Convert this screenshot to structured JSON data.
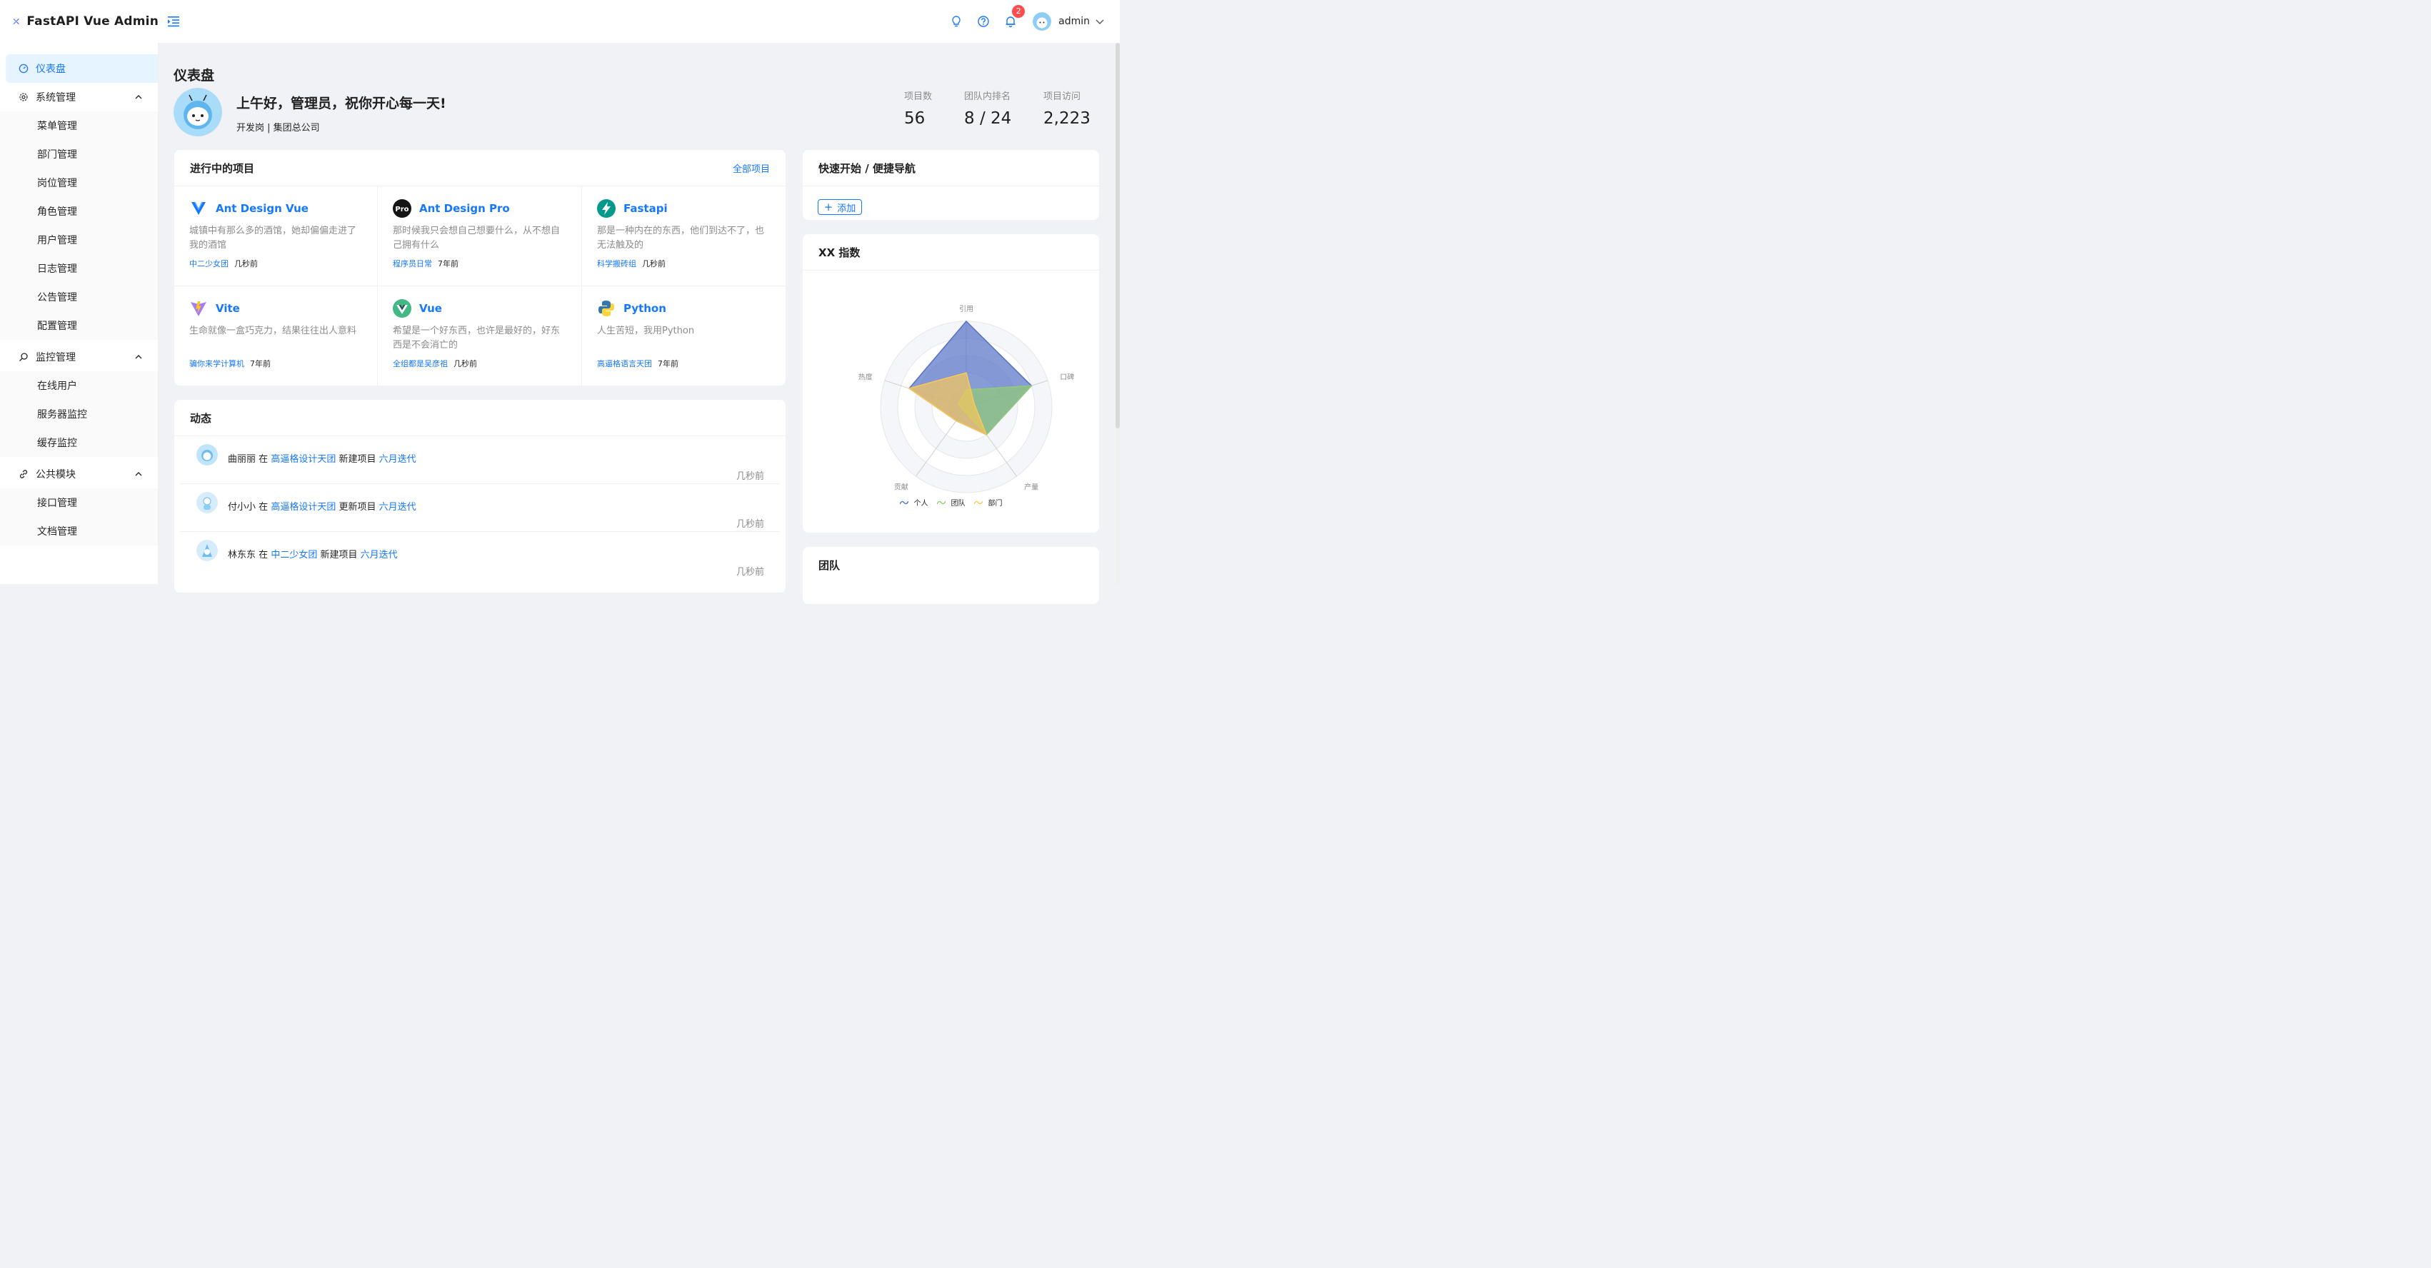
{
  "app": {
    "title": "FastAPI Vue Admin"
  },
  "header": {
    "notification_count": "2",
    "username": "admin",
    "icons": [
      "bulb-icon",
      "question-icon",
      "bell-icon",
      "chevron-down-icon"
    ]
  },
  "sidebar": {
    "dashboard": "仪表盘",
    "groups": [
      {
        "label": "系统管理",
        "icon": "gear-icon",
        "items": [
          "菜单管理",
          "部门管理",
          "岗位管理",
          "角色管理",
          "用户管理",
          "日志管理",
          "公告管理",
          "配置管理"
        ]
      },
      {
        "label": "监控管理",
        "icon": "search-icon",
        "items": [
          "在线用户",
          "服务器监控",
          "缓存监控"
        ]
      },
      {
        "label": "公共模块",
        "icon": "link-icon",
        "items": [
          "接口管理",
          "文档管理"
        ]
      }
    ]
  },
  "page": {
    "title": "仪表盘",
    "greeting": "上午好，管理员，祝你开心每一天!",
    "subtitle": "开发岗 | 集团总公司",
    "stats": [
      {
        "label": "项目数",
        "value": "56"
      },
      {
        "label": "团队内排名",
        "value": "8 / 24"
      },
      {
        "label": "项目访问",
        "value": "2,223"
      }
    ]
  },
  "projects": {
    "title": "进行中的项目",
    "all_link": "全部项目",
    "items": [
      {
        "name": "Ant Design Vue",
        "desc": "城镇中有那么多的酒馆，她却偏偏走进了我的酒馆",
        "group": "中二少女团",
        "time": "几秒前",
        "icon": "antdv-icon"
      },
      {
        "name": "Ant Design Pro",
        "desc": "那时候我只会想自己想要什么，从不想自己拥有什么",
        "group": "程序员日常",
        "time": "7年前",
        "icon": "pro-icon",
        "icon_text": "Pro"
      },
      {
        "name": "Fastapi",
        "desc": "那是一种内在的东西，他们到达不了，也无法触及的",
        "group": "科学搬砖组",
        "time": "几秒前",
        "icon": "fastapi-icon"
      },
      {
        "name": "Vite",
        "desc": "生命就像一盒巧克力，结果往往出人意料",
        "group": "骗你来学计算机",
        "time": "7年前",
        "icon": "vite-icon"
      },
      {
        "name": "Vue",
        "desc": "希望是一个好东西，也许是最好的，好东西是不会消亡的",
        "group": "全组都是吴彦祖",
        "time": "几秒前",
        "icon": "vue-icon"
      },
      {
        "name": "Python",
        "desc": "人生苦短，我用Python",
        "group": "高逼格语言天团",
        "time": "7年前",
        "icon": "python-icon"
      }
    ]
  },
  "dynamics": {
    "title": "动态",
    "items": [
      {
        "user": "曲丽丽",
        "at": "在",
        "group": "高逼格设计天团",
        "action": "新建项目",
        "target": "六月迭代",
        "time": "几秒前"
      },
      {
        "user": "付小小",
        "at": "在",
        "group": "高逼格设计天团",
        "action": "更新项目",
        "target": "六月迭代",
        "time": "几秒前"
      },
      {
        "user": "林东东",
        "at": "在",
        "group": "中二少女团",
        "action": "新建项目",
        "target": "六月迭代",
        "time": "几秒前"
      }
    ]
  },
  "quick": {
    "title": "快速开始 / 便捷导航",
    "add_label": "添加"
  },
  "index_card": {
    "title": "XX 指数"
  },
  "team": {
    "title": "团队"
  },
  "chart_data": {
    "type": "radar",
    "indicators": [
      "引用",
      "口碑",
      "产量",
      "贡献",
      "热度"
    ],
    "max": 10,
    "series": [
      {
        "name": "个人",
        "values": [
          10,
          8,
          4,
          2,
          7
        ],
        "color": "#5470c6"
      },
      {
        "name": "团队",
        "values": [
          2,
          8,
          4,
          0.5,
          1
        ],
        "color": "#91cc75"
      },
      {
        "name": "部门",
        "values": [
          4,
          1,
          4,
          2,
          7
        ],
        "color": "#fac858"
      }
    ],
    "legend_position": "bottom"
  },
  "colors": {
    "primary": "#1677ff",
    "badge": "#ff4d4f"
  }
}
